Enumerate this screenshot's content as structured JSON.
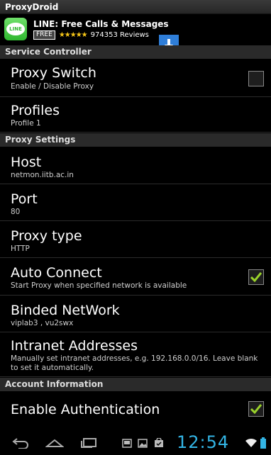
{
  "app": {
    "title": "ProxyDroid"
  },
  "ad": {
    "logo_text": "LINE",
    "title": "LINE: Free Calls & Messages",
    "badge": "FREE",
    "stars": "★★★★★",
    "reviews": "974353 Reviews",
    "download_icon": "download-arrow-icon"
  },
  "sections": {
    "service": "Service Controller",
    "proxy": "Proxy Settings",
    "account": "Account Information"
  },
  "prefs": {
    "proxy_switch": {
      "title": "Proxy Switch",
      "summary": "Enable / Disable Proxy",
      "checked": false
    },
    "profiles": {
      "title": "Profiles",
      "summary": "Profile 1"
    },
    "host": {
      "title": "Host",
      "summary": "netmon.iitb.ac.in"
    },
    "port": {
      "title": "Port",
      "summary": "80"
    },
    "proxy_type": {
      "title": "Proxy type",
      "summary": "HTTP"
    },
    "auto_connect": {
      "title": "Auto Connect",
      "summary": "Start Proxy when specified network is available",
      "checked": true
    },
    "binded_network": {
      "title": "Binded NetWork",
      "summary": "viplab3 , vu2swx"
    },
    "intranet": {
      "title": "Intranet Addresses",
      "summary": "Manually set intranet addresses, e.g. 192.168.0.0/16. Leave blank to set it automatically."
    },
    "enable_auth": {
      "title": "Enable Authentication",
      "checked": true
    }
  },
  "status": {
    "time": "12:54"
  },
  "colors": {
    "accent": "#33b5e5",
    "check": "#9ad22b"
  }
}
